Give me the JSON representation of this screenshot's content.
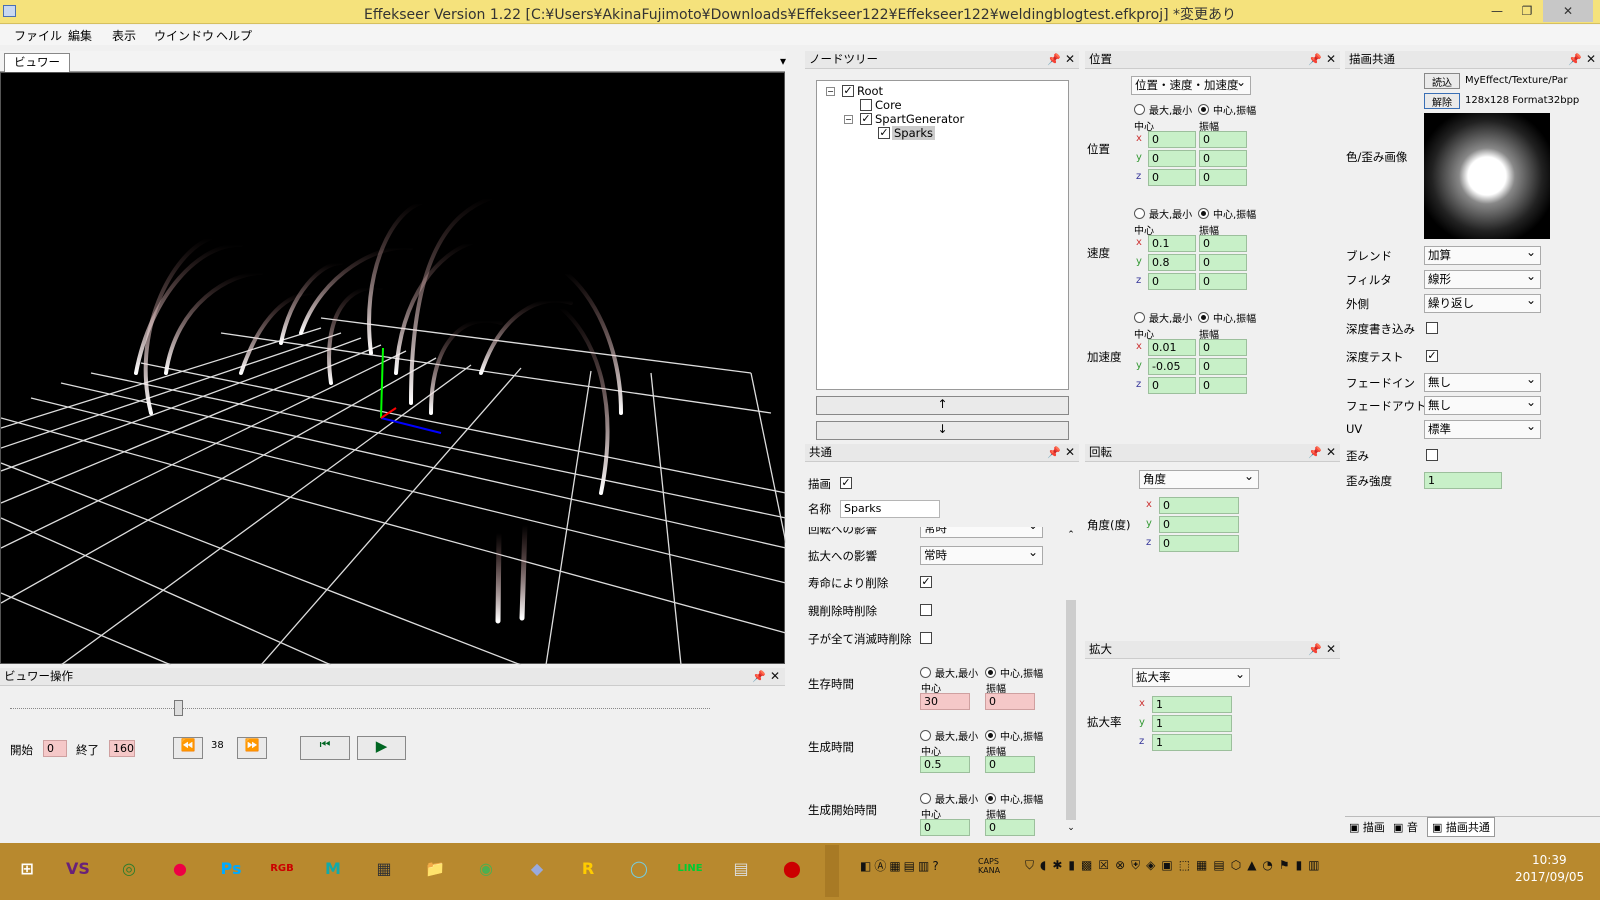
{
  "window": {
    "title": "Effekseer Version 1.22 [C:¥Users¥AkinaFujimoto¥Downloads¥Effekseer122¥Effekseer122¥weldingblogtest.efkproj]  *変更あり",
    "minimize": "—",
    "restore": "❐",
    "close": "✕"
  },
  "menu": [
    "ファイル",
    "編集",
    "表示",
    "ウインドウ",
    "ヘルプ"
  ],
  "viewer": {
    "tab": "ビュワー",
    "dropdown": "▾"
  },
  "viewer_ops": {
    "title": "ビュワー操作",
    "start_label": "開始",
    "start_value": "0",
    "end_label": "終了",
    "end_value": "160",
    "frame": "38",
    "rewind": "⏪",
    "forward": "⏩",
    "to_start": "⏮",
    "play": "▶",
    "pin": "📌",
    "close": "✕",
    "slider_fraction": 0.24
  },
  "node_tree": {
    "title": "ノードツリー",
    "nodes": [
      {
        "label": "Root",
        "checked": true
      },
      {
        "label": "Core",
        "checked": false
      },
      {
        "label": "SpartGenerator",
        "checked": true
      },
      {
        "label": "Sparks",
        "checked": true
      }
    ],
    "up": "↑",
    "down": "↓",
    "pin": "📌",
    "close": "✕"
  },
  "position": {
    "title": "位置",
    "mode": "位置・速度・加速度",
    "opt_minmax": "最大,最小",
    "opt_center": "中心,振幅",
    "col_center": "中心",
    "col_amp": "振幅",
    "groups": [
      {
        "label": "位置",
        "x": [
          "0",
          "0"
        ],
        "y": [
          "0",
          "0"
        ],
        "z": [
          "0",
          "0"
        ]
      },
      {
        "label": "速度",
        "x": [
          "0.1",
          "0"
        ],
        "y": [
          "0.8",
          "0"
        ],
        "z": [
          "0",
          "0"
        ]
      },
      {
        "label": "加速度",
        "x": [
          "0.01",
          "0"
        ],
        "y": [
          "-0.05",
          "0"
        ],
        "z": [
          "0",
          "0"
        ]
      }
    ],
    "axes": [
      "x",
      "y",
      "z"
    ]
  },
  "render_common": {
    "title": "描画共通",
    "load_btn": "読込",
    "unload_btn": "解除",
    "texture_path": "MyEffect/Texture/Par",
    "texture_info": "128x128 Format32bpp",
    "image_label": "色/歪み画像",
    "blend_label": "ブレンド",
    "blend": "加算",
    "filter_label": "フィルタ",
    "filter": "線形",
    "wrap_label": "外側",
    "wrap": "繰り返し",
    "depth_write_label": "深度書き込み",
    "depth_write": false,
    "depth_test_label": "深度テスト",
    "depth_test": true,
    "fadein_label": "フェードイン",
    "fadein": "無し",
    "fadeout_label": "フェードアウト",
    "fadeout": "無し",
    "uv_label": "UV",
    "uv": "標準",
    "distortion_label": "歪み",
    "distortion": false,
    "distortion_strength_label": "歪み強度",
    "distortion_strength": "1"
  },
  "common": {
    "title": "共通",
    "draw_label": "描画",
    "draw": true,
    "name_label": "名称",
    "name": "Sparks",
    "rot_inherit_label": "回転への影響",
    "rot_inherit": "常時",
    "scale_inherit_label": "拡大への影響",
    "scale_inherit": "常時",
    "remove_life_label": "寿命により削除",
    "remove_life": true,
    "remove_parent_label": "親削除時削除",
    "remove_parent": false,
    "remove_children_label": "子が全て消滅時削除",
    "remove_children": false,
    "opt_minmax": "最大,最小",
    "opt_center": "中心,振幅",
    "col_center": "中心",
    "col_amp": "振幅",
    "life_label": "生存時間",
    "life": [
      "30",
      "0"
    ],
    "gen_label": "生成時間",
    "gen": [
      "0.5",
      "0"
    ],
    "gen_start_label": "生成開始時間",
    "gen_start": [
      "0",
      "0"
    ]
  },
  "rotation": {
    "title": "回転",
    "mode": "角度",
    "label": "角度(度)",
    "x": "0",
    "y": "0",
    "z": "0"
  },
  "scale": {
    "title": "拡大",
    "mode": "拡大率",
    "label": "拡大率",
    "x": "1",
    "y": "1",
    "z": "1"
  },
  "bottom_tabs": [
    "描画",
    "音",
    "描画共通"
  ],
  "taskbar": {
    "apps": [
      "⊞",
      "VS",
      "◎",
      "●",
      "Ps",
      "RGB",
      "M",
      "▦",
      "📁",
      "◉",
      "◆",
      "R",
      "◯",
      "LINE",
      "▤",
      "⬤"
    ],
    "tray_text": "CAPS KANA",
    "time": "10:39",
    "date": "2017/09/05"
  },
  "colors": {
    "title": "#f5e27c",
    "taskbar": "#b8892e",
    "field_green": "#c8f0c8",
    "field_pink": "#f5c8c8"
  }
}
